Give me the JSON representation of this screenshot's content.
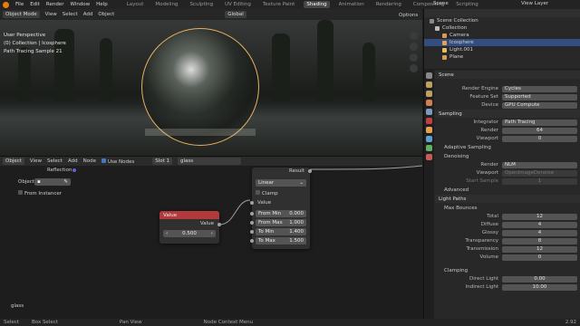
{
  "topbar": {
    "menus": [
      "File",
      "Edit",
      "Render",
      "Window",
      "Help"
    ],
    "workspaces": [
      "Layout",
      "Modeling",
      "Sculpting",
      "UV Editing",
      "Texture Paint",
      "Shading",
      "Animation",
      "Rendering",
      "Compositing",
      "Scripting"
    ],
    "active_workspace": "Shading",
    "scene": "Scene",
    "view_layer": "View Layer"
  },
  "viewport": {
    "mode": "Object Mode",
    "menus": [
      "View",
      "Select",
      "Add",
      "Object"
    ],
    "orientation": "Global",
    "options": "Options",
    "info_line1": "User Perspective",
    "info_line2": "(0) Collection | Icosphere",
    "info_line3": "Path Tracing Sample 21"
  },
  "node_editor": {
    "editor_type": "Object",
    "menus": [
      "View",
      "Select",
      "Add",
      "Node"
    ],
    "use_nodes_label": "Use Nodes",
    "slot": "Slot 1",
    "material": "glass",
    "bottom_label": "glass",
    "object_node": {
      "reflection_label": "Reflection",
      "object_label": "Object",
      "from_instancer": "From Instancer"
    },
    "value_node": {
      "title": "Value",
      "out_label": "Value",
      "value": "0.500"
    },
    "map_range_node": {
      "result_label": "Result",
      "interpolation": "Linear",
      "clamp_label": "Clamp",
      "value_label": "Value",
      "fields": [
        {
          "label": "From Min",
          "value": "0.000"
        },
        {
          "label": "From Max",
          "value": "1.000"
        },
        {
          "label": "To Min",
          "value": "1.400"
        },
        {
          "label": "To Max",
          "value": "1.500"
        }
      ]
    }
  },
  "outliner": {
    "root": "Scene Collection",
    "collection": "Collection",
    "items": [
      {
        "name": "Camera",
        "color": "#d99a52",
        "selected": false
      },
      {
        "name": "Icosphere",
        "color": "#e8a050",
        "selected": true
      },
      {
        "name": "Light.001",
        "color": "#e0c060",
        "selected": false
      },
      {
        "name": "Plane",
        "color": "#d99a52",
        "selected": false
      }
    ]
  },
  "properties": {
    "header": "Scene",
    "render_engine_label": "Render Engine",
    "render_engine": "Cycles",
    "feature_set_label": "Feature Set",
    "feature_set": "Supported",
    "device_label": "Device",
    "device": "GPU Compute",
    "sampling": "Sampling",
    "integrator_label": "Integrator",
    "integrator": "Path Tracing",
    "render_label": "Render",
    "render_samples": "64",
    "viewport_label": "Viewport",
    "viewport_samples": "0",
    "adaptive_sampling": "Adaptive Sampling",
    "denoising": "Denoising",
    "denoise_render_label": "Render",
    "denoise_render": "NLM",
    "denoise_viewport_label": "Viewport",
    "denoise_viewport": "OpenImageDenoise",
    "start_sample_label": "Start Sample",
    "start_sample": "1",
    "advanced": "Advanced",
    "light_paths": "Light Paths",
    "max_bounces": "Max Bounces",
    "bounces": [
      {
        "label": "Total",
        "value": "12"
      },
      {
        "label": "Diffuse",
        "value": "4"
      },
      {
        "label": "Glossy",
        "value": "4"
      },
      {
        "label": "Transparency",
        "value": "8"
      },
      {
        "label": "Transmission",
        "value": "12"
      },
      {
        "label": "Volume",
        "value": "0"
      }
    ],
    "clamping": "Clamping",
    "direct_light_label": "Direct Light",
    "direct_light": "0.00",
    "indirect_light_label": "Indirect Light",
    "indirect_light": "10.00"
  },
  "statusbar": {
    "items": [
      "Select",
      "Box Select",
      "Pan View",
      "Node Context Menu"
    ],
    "version": "2.92"
  }
}
